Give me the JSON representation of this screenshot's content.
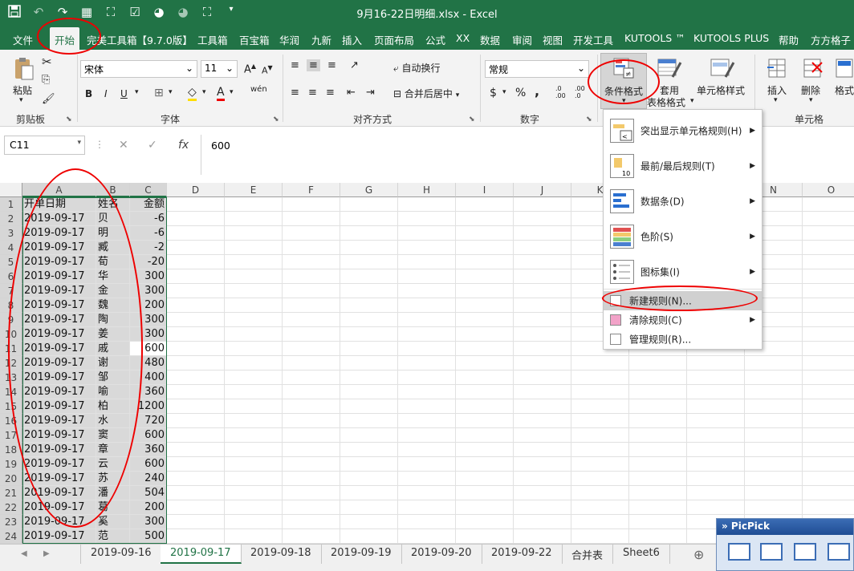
{
  "window": {
    "title": "9月16-22日明细.xlsx  -  Excel"
  },
  "qat": [
    "save-icon",
    "undo-icon",
    "redo-icon",
    "copy-format-icon",
    "screenshot-icon",
    "checkbox-icon",
    "chart-icon",
    "chart2-icon",
    "select-icon",
    "customize-icon"
  ],
  "menubar": {
    "tabs": [
      "文件",
      "开始",
      "完美工具箱【9.7.0版】",
      "工具箱",
      "百宝箱",
      "华润",
      "九新",
      "插入",
      "页面布局",
      "公式",
      "XX",
      "数据",
      "审阅",
      "视图",
      "开发工具",
      "KUTOOLS ™",
      "KUTOOLS PLUS",
      "帮助",
      "方方格子"
    ]
  },
  "ribbon": {
    "clipboard": {
      "paste": "粘贴",
      "label": "剪贴板"
    },
    "font": {
      "name": "宋体",
      "size": "11",
      "label": "字体",
      "bold": "B",
      "italic": "I",
      "underline": "U",
      "grow": "A",
      "shrink": "A",
      "wen": "wén"
    },
    "align": {
      "wrap": "自动换行",
      "merge": "合并后居中",
      "label": "对齐方式"
    },
    "number": {
      "format": "常规",
      "currency": "$",
      "percent": "%",
      "comma": ",",
      "label": "数字",
      "inc": ".0\n.00",
      "dec": ".00\n.0"
    },
    "styles": {
      "cond_format": "条件格式",
      "table_format_1": "套用",
      "table_format_2": "表格格式",
      "cell_style": "单元格样式"
    },
    "cells": {
      "insert": "插入",
      "delete": "删除",
      "format": "格式",
      "label": "单元格"
    }
  },
  "formula": {
    "namebox": "C11",
    "value": "600"
  },
  "columns": [
    "A",
    "B",
    "C",
    "D",
    "E",
    "F",
    "G",
    "H",
    "I",
    "J",
    "K",
    "L",
    "M",
    "N",
    "O"
  ],
  "rows": [
    {
      "n": "1",
      "a": "开单日期",
      "b": "姓名",
      "c": "金额"
    },
    {
      "n": "2",
      "a": "2019-09-17",
      "b": "贝",
      "c": "-6"
    },
    {
      "n": "3",
      "a": "2019-09-17",
      "b": "明",
      "c": "-6"
    },
    {
      "n": "4",
      "a": "2019-09-17",
      "b": "臧",
      "c": "-2"
    },
    {
      "n": "5",
      "a": "2019-09-17",
      "b": "荀",
      "c": "-20"
    },
    {
      "n": "6",
      "a": "2019-09-17",
      "b": "华",
      "c": "300"
    },
    {
      "n": "7",
      "a": "2019-09-17",
      "b": "金",
      "c": "300"
    },
    {
      "n": "8",
      "a": "2019-09-17",
      "b": "魏",
      "c": "200"
    },
    {
      "n": "9",
      "a": "2019-09-17",
      "b": "陶",
      "c": "300"
    },
    {
      "n": "10",
      "a": "2019-09-17",
      "b": "姜",
      "c": "300"
    },
    {
      "n": "11",
      "a": "2019-09-17",
      "b": "戚",
      "c": "600"
    },
    {
      "n": "12",
      "a": "2019-09-17",
      "b": "谢",
      "c": "480"
    },
    {
      "n": "13",
      "a": "2019-09-17",
      "b": "邹",
      "c": "400"
    },
    {
      "n": "14",
      "a": "2019-09-17",
      "b": "喻",
      "c": "360"
    },
    {
      "n": "15",
      "a": "2019-09-17",
      "b": "柏",
      "c": "1200"
    },
    {
      "n": "16",
      "a": "2019-09-17",
      "b": "水",
      "c": "720"
    },
    {
      "n": "17",
      "a": "2019-09-17",
      "b": "窦",
      "c": "600"
    },
    {
      "n": "18",
      "a": "2019-09-17",
      "b": "章",
      "c": "360"
    },
    {
      "n": "19",
      "a": "2019-09-17",
      "b": "云",
      "c": "600"
    },
    {
      "n": "20",
      "a": "2019-09-17",
      "b": "苏",
      "c": "240"
    },
    {
      "n": "21",
      "a": "2019-09-17",
      "b": "潘",
      "c": "504"
    },
    {
      "n": "22",
      "a": "2019-09-17",
      "b": "葛",
      "c": "200"
    },
    {
      "n": "23",
      "a": "2019-09-17",
      "b": "奚",
      "c": "300"
    },
    {
      "n": "24",
      "a": "2019-09-17",
      "b": "范",
      "c": "500"
    }
  ],
  "cf_menu": {
    "items": [
      {
        "label": "突出显示单元格规则(H)"
      },
      {
        "label": "最前/最后规则(T)"
      },
      {
        "label": "数据条(D)"
      },
      {
        "label": "色阶(S)"
      },
      {
        "label": "图标集(I)"
      }
    ],
    "small": [
      {
        "label": "新建规则(N)..."
      },
      {
        "label": "清除规则(C)"
      },
      {
        "label": "管理规则(R)..."
      }
    ]
  },
  "sheets": [
    "2019-09-16",
    "2019-09-17",
    "2019-09-18",
    "2019-09-19",
    "2019-09-20",
    "2019-09-22",
    "合并表",
    "Sheet6"
  ],
  "picpick": {
    "title": "» PicPick"
  },
  "colors": {
    "accent": "#217346",
    "annotation": "#e00000"
  }
}
